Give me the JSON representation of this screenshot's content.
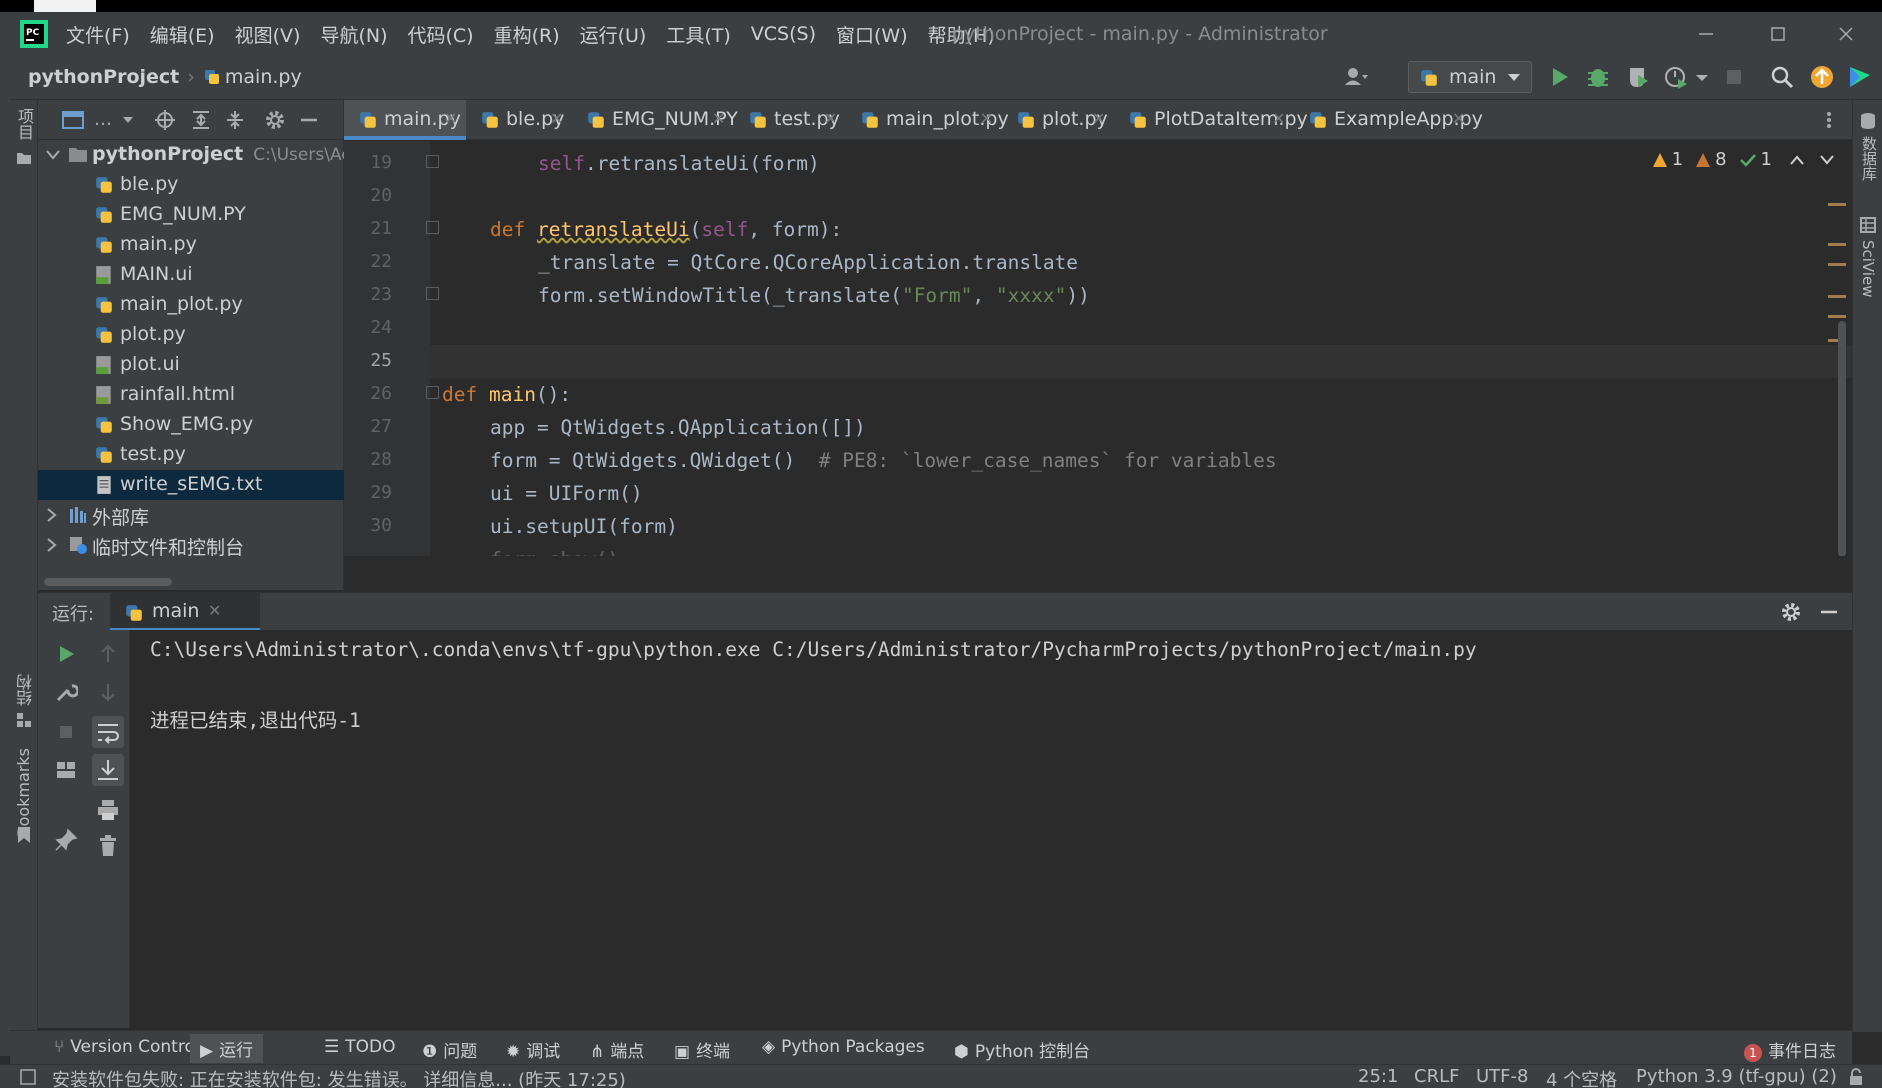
{
  "menu": [
    "文件(F)",
    "编辑(E)",
    "视图(V)",
    "导航(N)",
    "代码(C)",
    "重构(R)",
    "运行(U)",
    "工具(T)",
    "VCS(S)",
    "窗口(W)",
    "帮助(H)"
  ],
  "window_title": "pythonProject - main.py - Administrator",
  "breadcrumb": {
    "project": "pythonProject",
    "file": "main.py"
  },
  "run_config": {
    "label": "main"
  },
  "left_strip": {
    "project_label": "项目",
    "structure_label": "结构",
    "bookmarks_label": "Bookmarks"
  },
  "right_strip": {
    "database_label": "数据库",
    "sciview_label": "SciView"
  },
  "project_tree": {
    "root": {
      "name": "pythonProject",
      "path": "C:\\Users\\Ac"
    },
    "files": [
      "ble.py",
      "EMG_NUM.PY",
      "main.py",
      "MAIN.ui",
      "main_plot.py",
      "plot.py",
      "plot.ui",
      "rainfall.html",
      "Show_EMG.py",
      "test.py",
      "write_sEMG.txt"
    ],
    "selected": "write_sEMG.txt",
    "external_libs": "外部库",
    "scratches": "临时文件和控制台"
  },
  "editor_tabs": [
    "main.py",
    "ble.py",
    "EMG_NUM.PY",
    "test.py",
    "main_plot.py",
    "plot.py",
    "PlotDataItem.py",
    "ExampleApp.py"
  ],
  "active_tab": "main.py",
  "inspections": {
    "warnings": "1",
    "weak_warnings": "8",
    "typos": "1"
  },
  "code": {
    "line_numbers": [
      "19",
      "20",
      "21",
      "22",
      "23",
      "24",
      "25",
      "26",
      "27",
      "28",
      "29",
      "30"
    ],
    "current_line": "25",
    "l19_self": "self",
    "l19_rest": ".retranslateUi(form)",
    "l21_def": "def ",
    "l21_fn": "retranslateUi",
    "l21_open": "(",
    "l21_self": "self",
    "l21_rest": ", form):",
    "l22": "_translate = QtCore.QCoreApplication.translate",
    "l23_a": "form.setWindowTitle(_translate(",
    "l23_s1": "\"Form\"",
    "l23_comma": ", ",
    "l23_s2": "\"xxxx\"",
    "l23_close": "))",
    "l26_def": "def ",
    "l26_fn": "main",
    "l26_rest": "():",
    "l27": "app = QtWidgets.QApplication([])",
    "l28_code": "form = QtWidgets.QWidget()  ",
    "l28_comment": "# PE8: `lower_case_names` for variables",
    "l29": "ui = UIForm()",
    "l30": "ui.setupUI(form)"
  },
  "run_panel": {
    "label": "运行:",
    "tab": "main",
    "command": "C:\\Users\\Administrator\\.conda\\envs\\tf-gpu\\python.exe C:/Users/Administrator/PycharmProjects/pythonProject/main.py",
    "exit_message": "进程已结束,退出代码-1"
  },
  "tool_tabs": [
    "Version Control",
    "运行",
    "TODO",
    "问题",
    "调试",
    "端点",
    "终端",
    "Python Packages",
    "Python 控制台"
  ],
  "event_log": {
    "count": "1",
    "label": "事件日志"
  },
  "status": {
    "message": "安装软件包失败: 正在安装软件包: 发生错误。 详细信息... (昨天 17:25)",
    "position": "25:1",
    "line_sep": "CRLF",
    "encoding": "UTF-8",
    "indent": "4 个空格",
    "interpreter": "Python 3.9 (tf-gpu) (2)"
  },
  "colors": {
    "accent": "#4a88c7",
    "run_green": "#59a869",
    "keyword": "#cc7832",
    "function": "#ffc66d",
    "string": "#6a8759"
  }
}
